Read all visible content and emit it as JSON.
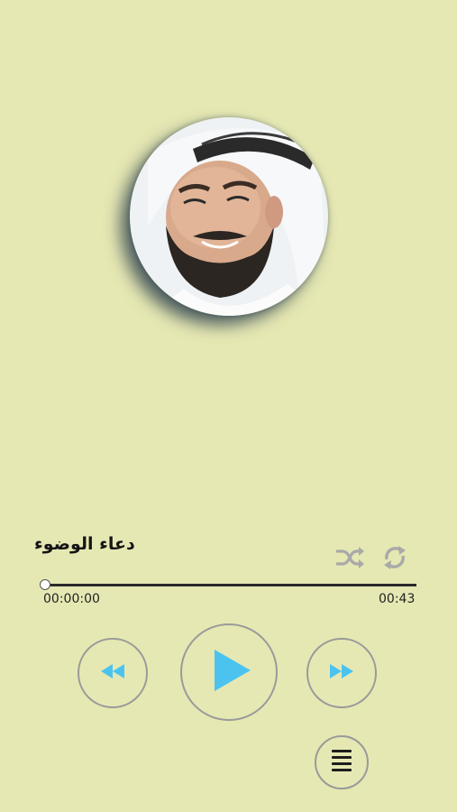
{
  "player": {
    "track_title": "دعاء الوضوء",
    "elapsed_time": "00:00:00",
    "total_time": "00:43",
    "progress_fraction": 0
  },
  "colors": {
    "background": "#e6e8b3",
    "accent": "#4cc3ef",
    "secondary_icon": "#a9a9a9",
    "button_border": "#9a9a9a"
  },
  "icons": {
    "shuffle": "shuffle-icon",
    "repeat": "repeat-icon",
    "previous": "rewind-icon",
    "play": "play-icon",
    "next": "fast-forward-icon",
    "playlist": "list-icon"
  }
}
